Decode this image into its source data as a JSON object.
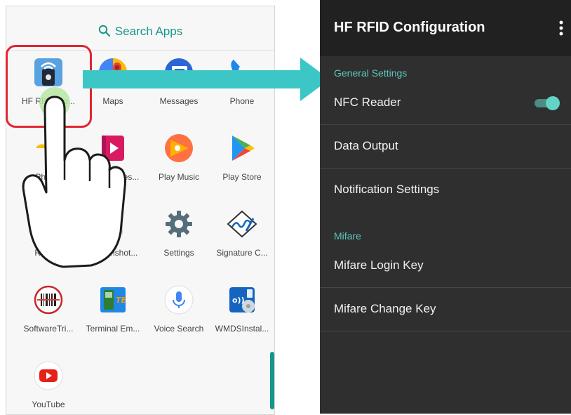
{
  "drawer": {
    "search_label": "Search Apps",
    "apps": [
      {
        "label": "HF RFID Co...",
        "icon": "hf-rfid-icon"
      },
      {
        "label": "Maps",
        "icon": "maps-icon"
      },
      {
        "label": "Messages",
        "icon": "messages-icon"
      },
      {
        "label": "Phone",
        "icon": "phone-icon"
      },
      {
        "label": "Photos",
        "icon": "photos-icon"
      },
      {
        "label": "Play Movies...",
        "icon": "play-movies-icon"
      },
      {
        "label": "Play Music",
        "icon": "play-music-icon"
      },
      {
        "label": "Play Store",
        "icon": "play-store-icon"
      },
      {
        "label": "Reader",
        "icon": "reader-icon"
      },
      {
        "label": "Screenshot...",
        "icon": "screenshot-icon"
      },
      {
        "label": "Settings",
        "icon": "settings-icon"
      },
      {
        "label": "Signature C...",
        "icon": "signature-icon"
      },
      {
        "label": "SoftwareTri...",
        "icon": "barcode-icon"
      },
      {
        "label": "Terminal Em...",
        "icon": "terminal-emulator-icon"
      },
      {
        "label": "Voice Search",
        "icon": "microphone-icon"
      },
      {
        "label": "WMDSInstal...",
        "icon": "wmds-install-icon"
      },
      {
        "label": "YouTube",
        "icon": "youtube-icon"
      }
    ]
  },
  "settings": {
    "title": "HF RFID Configuration",
    "sections": [
      {
        "header": "General Settings",
        "items": [
          {
            "label": "NFC Reader",
            "toggle": true
          },
          {
            "label": "Data Output"
          },
          {
            "label": "Notification Settings"
          }
        ]
      },
      {
        "header": "Mifare",
        "items": [
          {
            "label": "Mifare Login Key"
          },
          {
            "label": "Mifare Change Key"
          }
        ]
      }
    ]
  },
  "colors": {
    "accent": "#16968a",
    "highlight": "#e2262f",
    "arrow": "#3cc7c6",
    "toolbar": "#212121",
    "settings_bg": "#2f2f2f",
    "category": "#5cc8bc"
  }
}
